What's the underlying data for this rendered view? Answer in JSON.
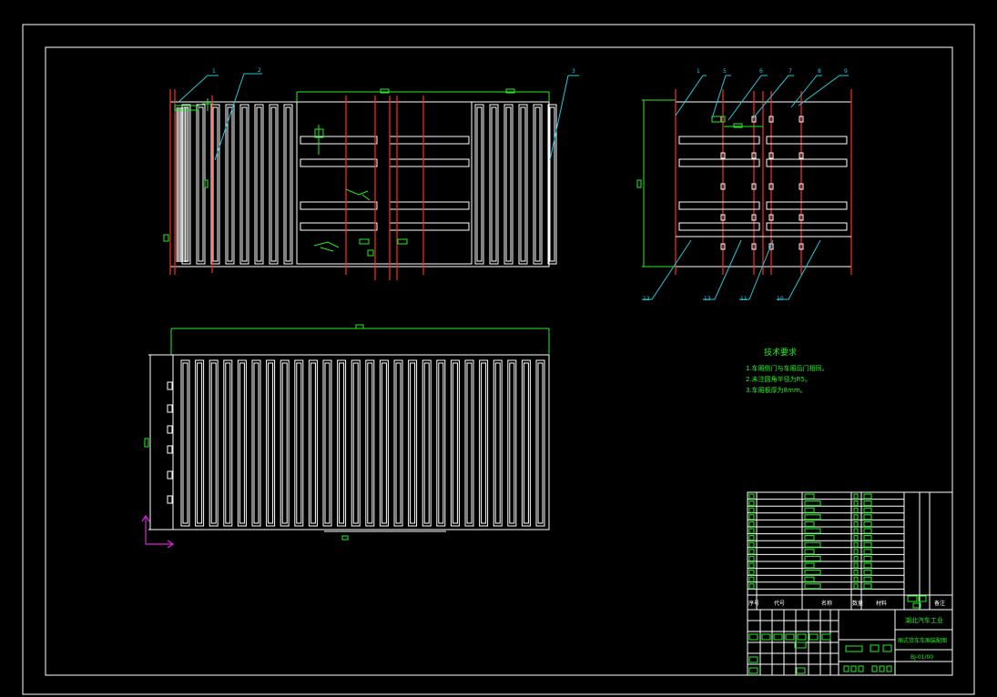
{
  "colors": {
    "background": "#000000",
    "outline": "#ffffff",
    "dimension": "#22ee22",
    "centerline": "#ff2a2a",
    "leader": "#22c7d8",
    "ucs": "#dd22dd"
  },
  "technical_requirements": {
    "title": "技术要求",
    "items": [
      "1.车厢侧门与车厢后门相同。",
      "2.未注圆角半径为R5。",
      "3.车厢板厚为8mm。"
    ]
  },
  "title_block": {
    "school": "湖北汽车工业",
    "drawing_name": "厢式货车车厢装配图",
    "drawing_no": "BJ-01/00",
    "header_no": "序号",
    "header_code": "代号",
    "header_name": "名称",
    "header_qty": "数量",
    "header_material": "材料",
    "header_remark": "备注"
  },
  "callouts_left_view": [
    "1",
    "2",
    "3"
  ],
  "callouts_right_view": [
    "1",
    "5",
    "6",
    "7",
    "8",
    "9"
  ],
  "callouts_right_view_bottom": [
    "12",
    "13",
    "11",
    "10"
  ]
}
